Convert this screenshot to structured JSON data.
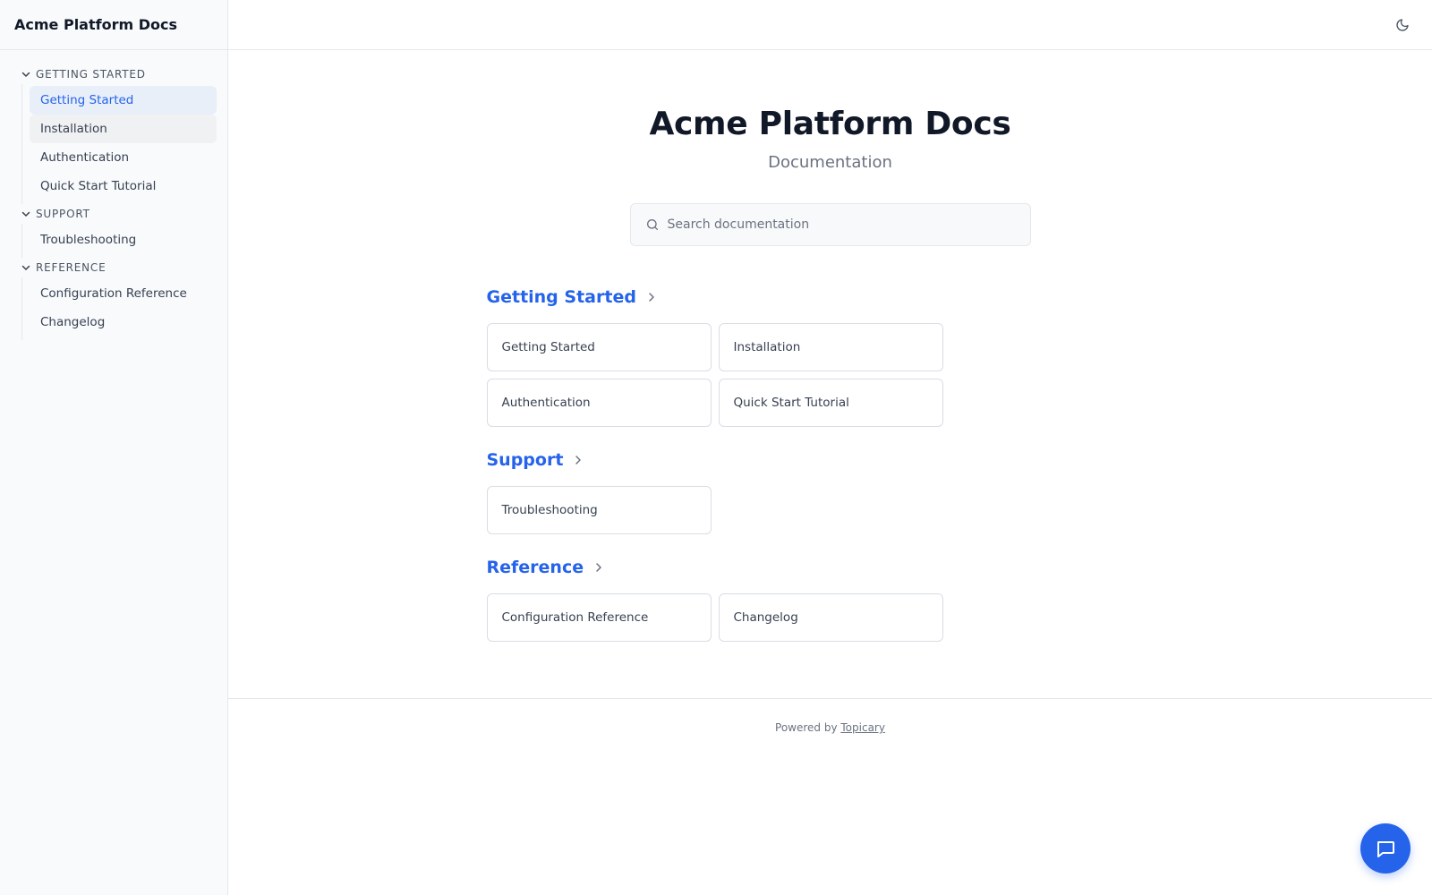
{
  "site": {
    "title": "Acme Platform Docs"
  },
  "sidebar": {
    "groups": [
      {
        "label": "GETTING STARTED",
        "items": [
          {
            "label": "Getting Started",
            "state": "active"
          },
          {
            "label": "Installation",
            "state": "hover"
          },
          {
            "label": "Authentication"
          },
          {
            "label": "Quick Start Tutorial"
          }
        ]
      },
      {
        "label": "SUPPORT",
        "items": [
          {
            "label": "Troubleshooting"
          }
        ]
      },
      {
        "label": "REFERENCE",
        "items": [
          {
            "label": "Configuration Reference"
          },
          {
            "label": "Changelog"
          }
        ]
      }
    ]
  },
  "topbar": {
    "theme_icon": "moon-icon"
  },
  "hero": {
    "title": "Acme Platform Docs",
    "subtitle": "Documentation"
  },
  "search": {
    "placeholder": "Search documentation",
    "value": ""
  },
  "sections": [
    {
      "title": "Getting Started",
      "cards": [
        "Getting Started",
        "Installation",
        "Authentication",
        "Quick Start Tutorial"
      ]
    },
    {
      "title": "Support",
      "cards": [
        "Troubleshooting"
      ]
    },
    {
      "title": "Reference",
      "cards": [
        "Configuration Reference",
        "Changelog"
      ]
    }
  ],
  "footer": {
    "prefix": "Powered by",
    "link": "Topicary"
  },
  "chat": {
    "icon": "chat-icon"
  },
  "colors": {
    "accent": "#2563eb",
    "active_bg": "#e8eff9",
    "sidebar_bg": "#f8fafc"
  }
}
